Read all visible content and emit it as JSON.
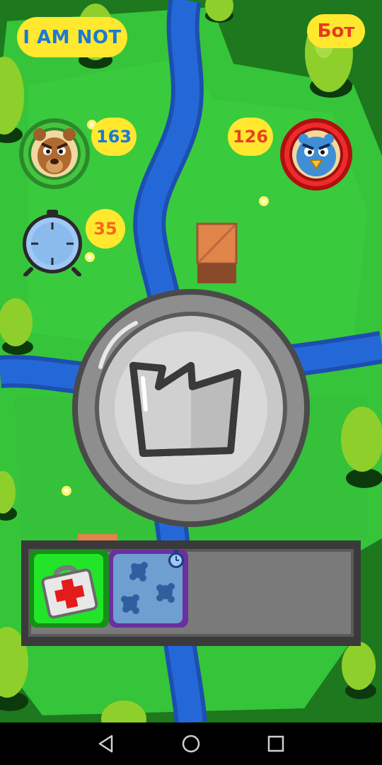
{
  "player": {
    "name": "I AM NOT",
    "score": "163"
  },
  "bot": {
    "name": "Бот",
    "score": "126"
  },
  "timer": {
    "value": "35"
  },
  "center_button": {
    "icon": "crown-icon"
  },
  "inventory": {
    "items": [
      {
        "icon": "first-aid-kit-icon"
      },
      {
        "icon": "snowflake-freeze-icon",
        "badge_icon": "stopwatch-icon"
      }
    ]
  },
  "navigation": {
    "back_icon": "triangle-back-icon",
    "home_icon": "circle-home-icon",
    "recents_icon": "square-recents-icon"
  },
  "colors": {
    "grass": "#36c43a",
    "river": "#2468d8",
    "player_ring": "#2fa12f",
    "bot_ring": "#e01f1f",
    "pill": "#ffe82e",
    "freeze_border": "#8c3cc4",
    "medkit_bg": "#22e52a"
  }
}
